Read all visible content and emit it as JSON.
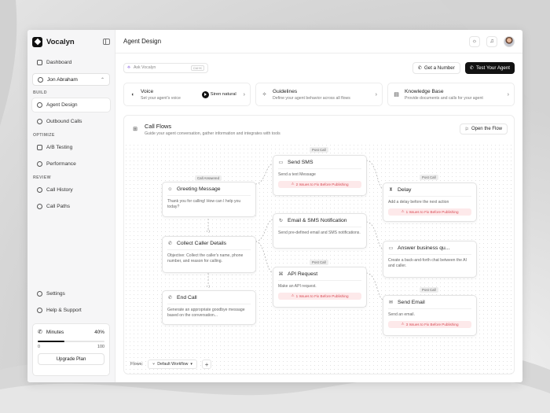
{
  "app": {
    "name": "Vocalyn"
  },
  "sidebar": {
    "dashboard": "Dashboard",
    "user": "Jon Abraham",
    "sections": {
      "build": "BUILD",
      "optimize": "OPTIMIZE",
      "review": "REVIEW"
    },
    "build_items": [
      "Agent Design",
      "Outbound Calls"
    ],
    "optimize_items": [
      "A/B Testing",
      "Performance"
    ],
    "review_items": [
      "Call History",
      "Call Paths"
    ],
    "settings": "Settings",
    "help": "Help & Support",
    "minutes": {
      "label": "Minutes",
      "percent_text": "40%",
      "percent": 40,
      "min": "0",
      "max": "100",
      "upgrade": "Upgrade Plan"
    }
  },
  "header": {
    "title": "Agent Design"
  },
  "toolbar": {
    "ask_placeholder": "Ask Vocalyn",
    "ask_shortcut": "Ctrl+K",
    "get_number": "Get a Number",
    "test_agent": "Test Your Agent"
  },
  "cards": [
    {
      "title": "Voice",
      "sub": "Set your agent's voice",
      "badge": "Siren natural"
    },
    {
      "title": "Guidelines",
      "sub": "Define your agent behavior across all flows"
    },
    {
      "title": "Knowledge Base",
      "sub": "Provide documents and calls for your agent"
    }
  ],
  "flow": {
    "title": "Call Flows",
    "subtitle": "Guide your agent conversation, gather information and integrates with tools",
    "open": "Open the Flow",
    "flows_label": "Flows:",
    "workflow": "Default Workflow",
    "nodes": {
      "greeting": {
        "tag": "Call Answered",
        "title": "Greeting Message",
        "desc": "Thank you for calling! How can I help you today?"
      },
      "collect": {
        "title": "Collect Caller Details",
        "desc": "Objective: Collect the caller's name, phone number, and reason for calling."
      },
      "endcall": {
        "title": "End Call",
        "desc": "Generate an appropriate goodbye message based on the conversation..."
      },
      "sms": {
        "tag": "Post Call",
        "title": "Send SMS",
        "desc": "Send a text Message",
        "warn": "2 Issues to Fix Before Publishing"
      },
      "notify": {
        "title": "Email & SMS Notification",
        "desc": "Send pre-defined email and SMS notifications."
      },
      "api": {
        "tag": "Post Call",
        "title": "API Request",
        "desc": "Make an API request.",
        "warn": "1 Issues to Fix Before Publishing"
      },
      "delay": {
        "tag": "Post Call",
        "title": "Delay",
        "desc": "Add a delay before the next action",
        "warn": "1 Issues to Fix Before Publishing"
      },
      "answer": {
        "title": "Answer business qu...",
        "desc": "Create a back-and-forth chat between the AI and caller."
      },
      "email": {
        "tag": "Post Call",
        "title": "Send Email",
        "desc": "Send an email.",
        "warn": "3 Issues to Fix Before Publishing"
      }
    }
  }
}
